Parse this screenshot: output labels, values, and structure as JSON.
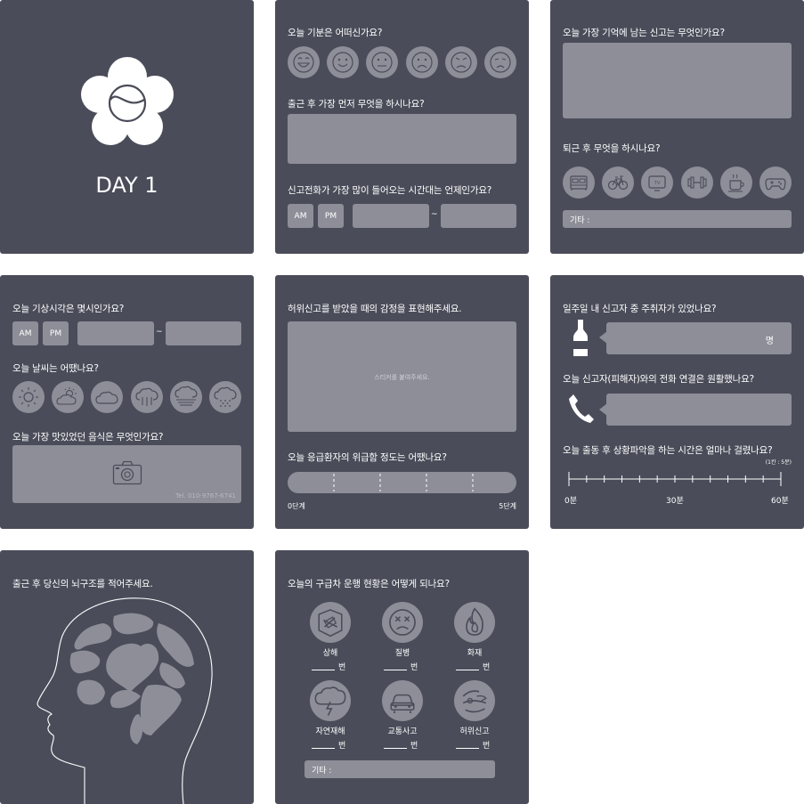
{
  "card1": {
    "title": "DAY 1"
  },
  "card2": {
    "q_mood": "오늘 기분은 어떠신가요?",
    "q_first": "출근 후 가장 먼저 무엇을 하시나요?",
    "q_time": "신고전화가 가장 많이 들어오는 시간대는 언제인가요?",
    "am": "AM",
    "pm": "PM",
    "tilde": "~",
    "moods": [
      "very-happy-face-icon",
      "smile-face-icon",
      "neutral-face-icon",
      "sad-face-icon",
      "angry-face-icon",
      "crying-face-icon"
    ]
  },
  "card3": {
    "q_memory": "오늘 가장 기억에 남는 신고는 무엇인가요?",
    "q_after": "퇴근 후 무엇을 하시나요?",
    "other": "기타 :",
    "activities": [
      "bed-icon",
      "bicycle-icon",
      "tv-icon",
      "dumbbell-icon",
      "coffee-icon",
      "gamepad-icon"
    ],
    "tv_text": "TV"
  },
  "card4": {
    "q_wake": "오늘 기상시각은 몇시인가요?",
    "am": "AM",
    "pm": "PM",
    "tilde": "~",
    "q_weather": "오늘 날씨는 어땠나요?",
    "weather": [
      "sun-icon",
      "partly-cloudy-icon",
      "cloud-icon",
      "rain-icon",
      "fog-icon",
      "snow-icon"
    ],
    "q_food": "오늘 가장 맛있었던 음식은 무엇인가요?",
    "tel": "Tel. 010-9767-6741"
  },
  "card5": {
    "q_emotion": "허위신고를 받았을 때의 감정을 표현해주세요.",
    "sticker_hint": "스티커를 붙여주세요.",
    "q_urgency": "오늘 응급환자의 위급함 정도는 어땠나요?",
    "min_label": "0단계",
    "max_label": "5단계"
  },
  "card6": {
    "q_drunk": "일주일 내 신고자 중 주취자가 있었나요?",
    "unit": "명",
    "q_call": "오늘 신고자(피해자)와의 전화 연결은 원활했나요?",
    "q_dispatch": "오늘 출동 후 상황파악을 하는 시간은 얼마나 걸렸나요?",
    "scale_note": "(1칸 : 5분)",
    "ticks": [
      "0분",
      "30분",
      "60분"
    ]
  },
  "card7": {
    "q_brain": "출근 후 당신의 뇌구조를 적어주세요."
  },
  "card8": {
    "q_ambulance": "오늘의 구급차 운행 현황은 어떻게 되나요?",
    "unit": "번",
    "categories": [
      {
        "label": "상해",
        "icon": "injury-icon"
      },
      {
        "label": "질병",
        "icon": "illness-icon"
      },
      {
        "label": "화재",
        "icon": "fire-icon"
      },
      {
        "label": "자연재해",
        "icon": "storm-icon"
      },
      {
        "label": "교통사고",
        "icon": "car-crash-icon"
      },
      {
        "label": "허위신고",
        "icon": "false-report-icon"
      }
    ],
    "other": "기타 :"
  },
  "colors": {
    "card_bg": "#4a4c59",
    "field": "#8d8e98",
    "text": "#ffffff"
  }
}
